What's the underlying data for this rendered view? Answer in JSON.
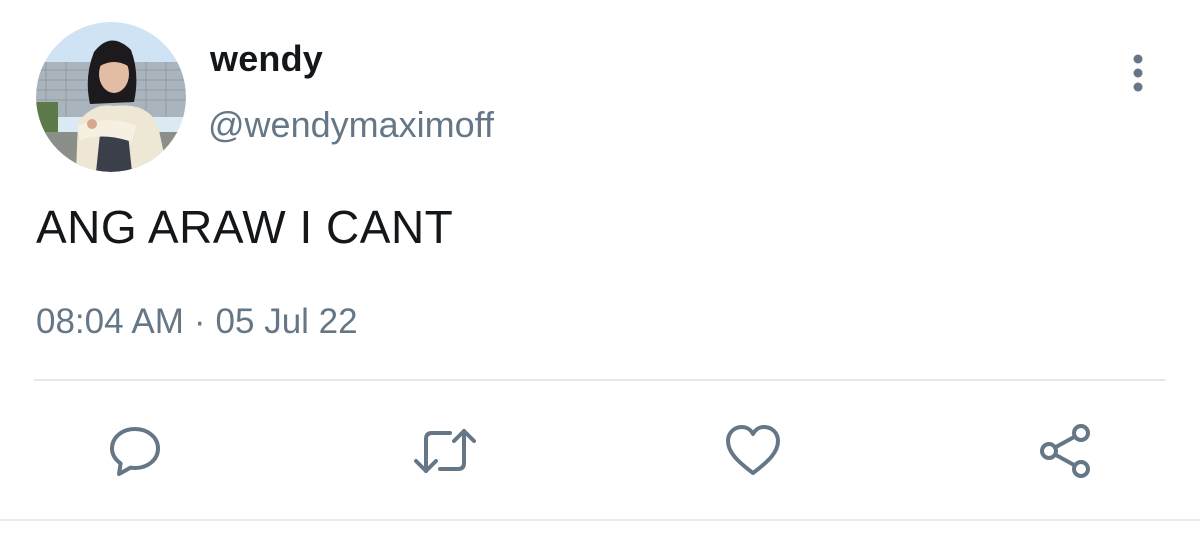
{
  "tweet": {
    "author": {
      "display_name": "wendy",
      "handle": "@wendymaximoff",
      "avatar": "avatar"
    },
    "text": "ANG ARAW I CANT",
    "time": "08:04 AM",
    "separator": "·",
    "date": "05 Jul 22",
    "menu_icon": "more-vertical-icon",
    "actions": [
      {
        "name": "reply",
        "icon": "comment-icon"
      },
      {
        "name": "retweet",
        "icon": "retweet-icon"
      },
      {
        "name": "like",
        "icon": "heart-icon"
      },
      {
        "name": "share",
        "icon": "share-icon"
      }
    ]
  },
  "colors": {
    "text_primary": "#14171a",
    "text_secondary": "#657786",
    "icon": "#657786",
    "divider": "#e1e8ed",
    "background": "#ffffff"
  }
}
